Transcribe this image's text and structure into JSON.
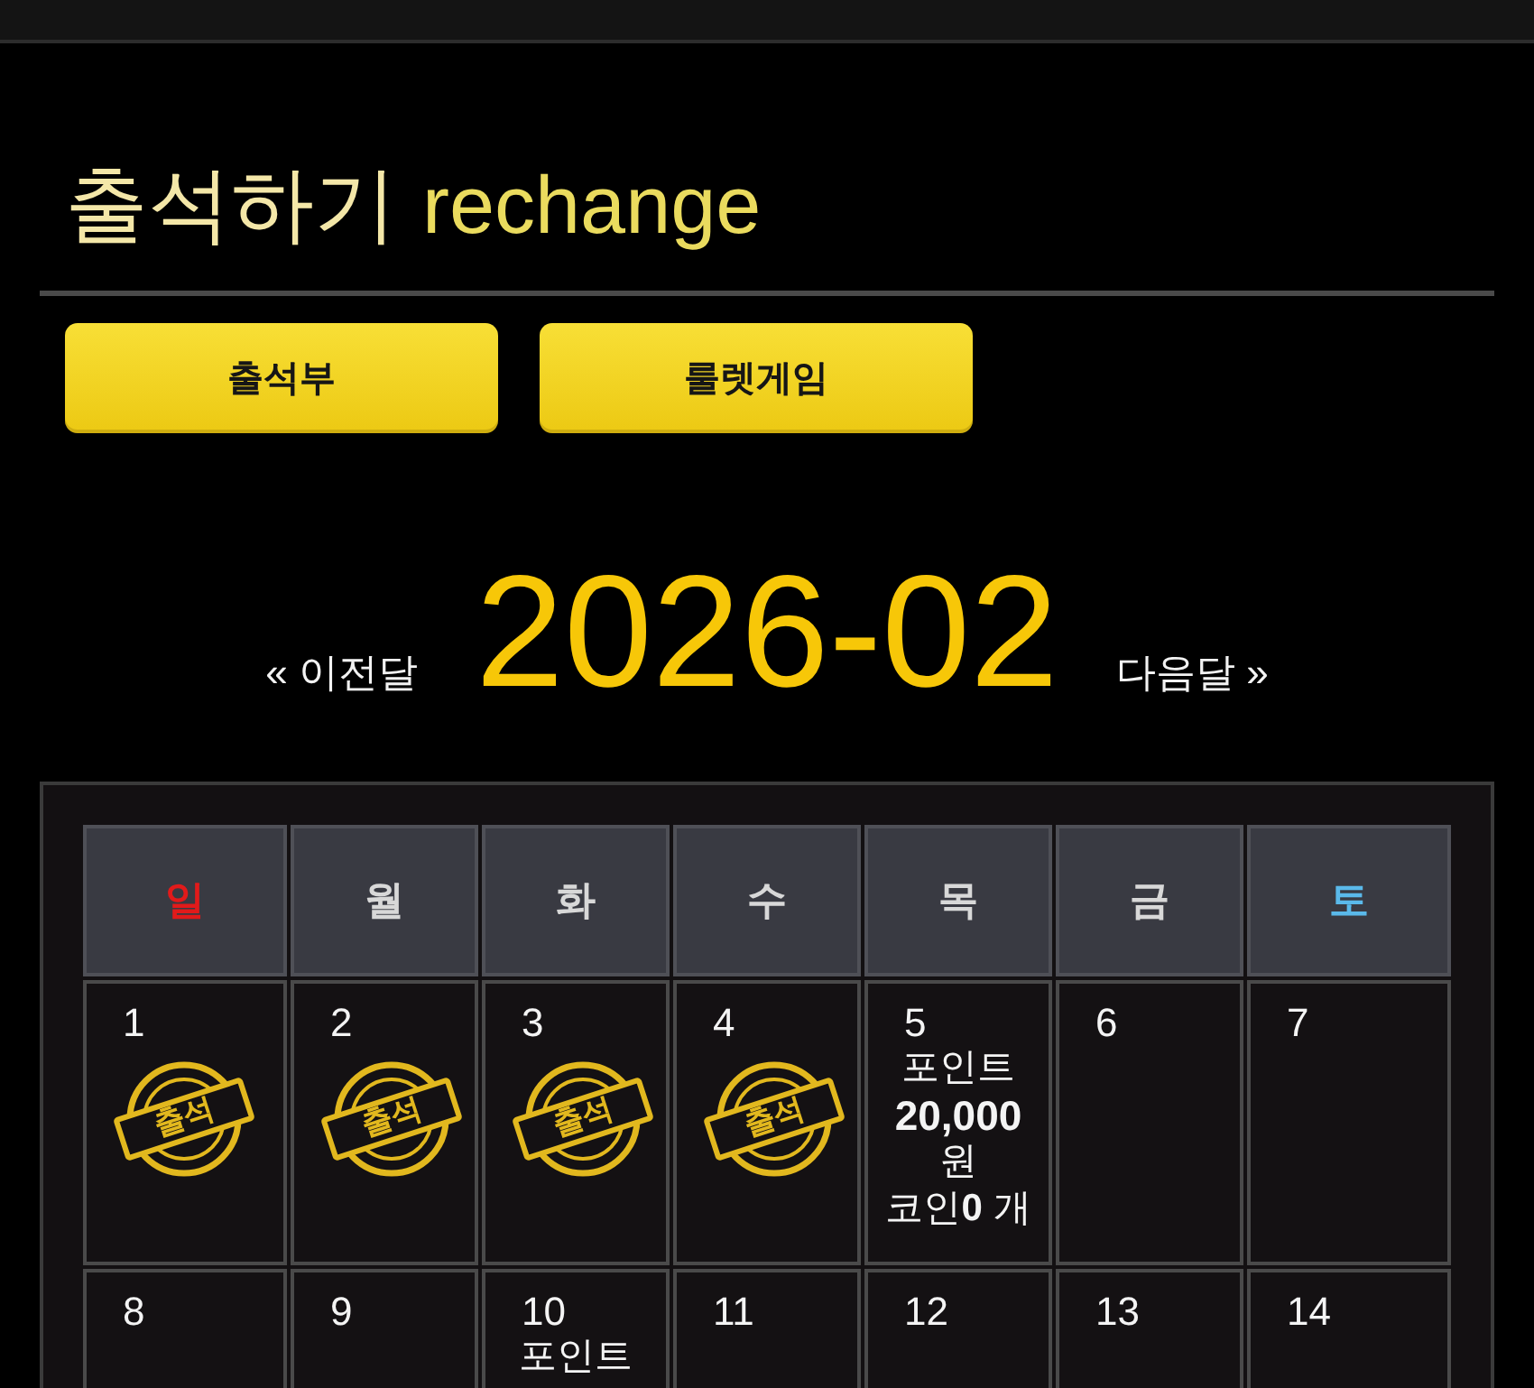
{
  "header": {
    "title": "출석하기",
    "subtitle": "rechange"
  },
  "buttons": [
    {
      "label": "출석부"
    },
    {
      "label": "룰렛게임"
    }
  ],
  "month_nav": {
    "previous": "« 이전달",
    "current": "2026-02",
    "next": "다음달 »"
  },
  "calendar": {
    "weekdays": [
      {
        "label": "일",
        "color": "#e21a1a"
      },
      {
        "label": "월",
        "color": "#d8d8d8"
      },
      {
        "label": "화",
        "color": "#d8d8d8"
      },
      {
        "label": "수",
        "color": "#d8d8d8"
      },
      {
        "label": "목",
        "color": "#d8d8d8"
      },
      {
        "label": "금",
        "color": "#d8d8d8"
      },
      {
        "label": "토",
        "color": "#5ab9ea"
      }
    ],
    "weeks": [
      [
        {
          "day": "1",
          "stamp": "출석"
        },
        {
          "day": "2",
          "stamp": "출석"
        },
        {
          "day": "3",
          "stamp": "출석"
        },
        {
          "day": "4",
          "stamp": "출석"
        },
        {
          "day": "5",
          "reward": {
            "label": "포인트",
            "amount": "20,000",
            "unit": "원",
            "coin": "코인**0** 개"
          }
        },
        {
          "day": "6"
        },
        {
          "day": "7"
        }
      ],
      [
        {
          "day": "8"
        },
        {
          "day": "9"
        },
        {
          "day": "10",
          "reward": {
            "label": "포인트"
          }
        },
        {
          "day": "11"
        },
        {
          "day": "12"
        },
        {
          "day": "13"
        },
        {
          "day": "14"
        }
      ]
    ]
  }
}
